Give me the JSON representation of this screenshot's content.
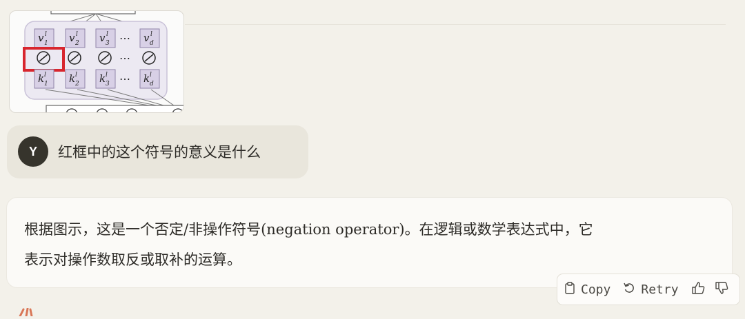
{
  "attachment": {
    "top_row": [
      "v",
      "v",
      "v",
      "v"
    ],
    "top_sup": [
      "l",
      "l",
      "l",
      "l"
    ],
    "top_sub": [
      "1",
      "2",
      "3",
      "d"
    ],
    "bottom_row": [
      "k",
      "k",
      "k",
      "k"
    ],
    "bottom_sup": [
      "l",
      "l",
      "l",
      "l"
    ],
    "bottom_sub": [
      "1",
      "2",
      "3",
      "d"
    ],
    "ellipsis": "⋯",
    "highlight_color": "#d8262e",
    "cell_fill": "#d8d0e6"
  },
  "user": {
    "avatar_initial": "Y",
    "message": "红框中的这个符号的意义是什么"
  },
  "assistant": {
    "line1": "根据图示，这是一个否定/非操作符号(negation operator)。在逻辑或数学表达式中，它",
    "line2": "表示对操作数取反或取补的运算。"
  },
  "actions": {
    "copy_label": "Copy",
    "retry_label": "Retry"
  },
  "colors": {
    "background": "#f3f1ea",
    "user_bubble": "#e9e6dc",
    "assistant_bubble": "#fbfaf7",
    "brand": "#d97757"
  }
}
